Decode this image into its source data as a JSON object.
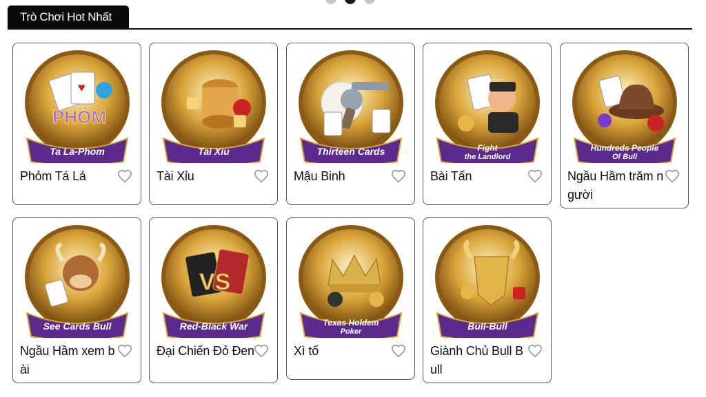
{
  "carousel": {
    "dots": 3,
    "active_index": 1
  },
  "section": {
    "title": "Trò Chơi Hot Nhất"
  },
  "colors": {
    "gold": "#d7a43a",
    "purple": "#5b2a8c",
    "tab_bg": "#0b0b0b"
  },
  "games": [
    {
      "name": "Phỏm Tá Lả",
      "banner": "Ta La-Phom",
      "banner_line2": "",
      "theme": "cards",
      "liked": false
    },
    {
      "name": "Tài Xỉu",
      "banner": "Tai Xiu",
      "banner_line2": "",
      "theme": "dice",
      "liked": false
    },
    {
      "name": "Mậu Binh",
      "banner": "Thirteen Cards",
      "banner_line2": "",
      "theme": "revolver",
      "liked": false
    },
    {
      "name": "Bài Tấn",
      "banner": "Fight",
      "banner_line2": "the Landlord",
      "theme": "landlord",
      "liked": false
    },
    {
      "name": "Ngầu Hầm trăm người",
      "banner": "Hundreds People",
      "banner_line2": "Of Bull",
      "theme": "hat",
      "liked": false
    },
    {
      "name": "Ngầu Hầm xem bài",
      "banner": "See Cards Bull",
      "banner_line2": "",
      "theme": "bull",
      "liked": false
    },
    {
      "name": "Đại Chiến Đỏ Đen",
      "banner": "Red-Black War",
      "banner_line2": "",
      "theme": "vs",
      "liked": false
    },
    {
      "name": "Xì tố",
      "banner": "Texas Holdem",
      "banner_line2": "Poker",
      "theme": "crown",
      "liked": false
    },
    {
      "name": "Giành Chủ Bull Bull",
      "banner": "Bull-Bull",
      "banner_line2": "",
      "theme": "goldbull",
      "liked": false
    }
  ]
}
